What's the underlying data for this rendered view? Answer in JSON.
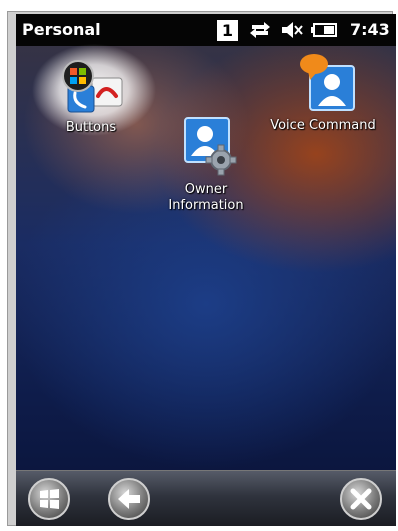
{
  "status_bar": {
    "title": "Personal",
    "notification_count": "1",
    "time": "7:43",
    "icons": [
      "connectivity-icon",
      "volume-muted-icon",
      "battery-icon"
    ]
  },
  "apps": [
    {
      "label": "Buttons",
      "icon": "buttons-icon"
    },
    {
      "label": "Owner Information",
      "line1": "Owner",
      "line2": "Information",
      "icon": "owner-info-icon"
    },
    {
      "label": "Voice Command",
      "icon": "voice-command-icon"
    }
  ],
  "taskbar": {
    "buttons": [
      "start-button",
      "back-button",
      "close-button"
    ]
  },
  "colors": {
    "accent_blue": "#2a7fd8",
    "orange": "#f08a1a"
  }
}
